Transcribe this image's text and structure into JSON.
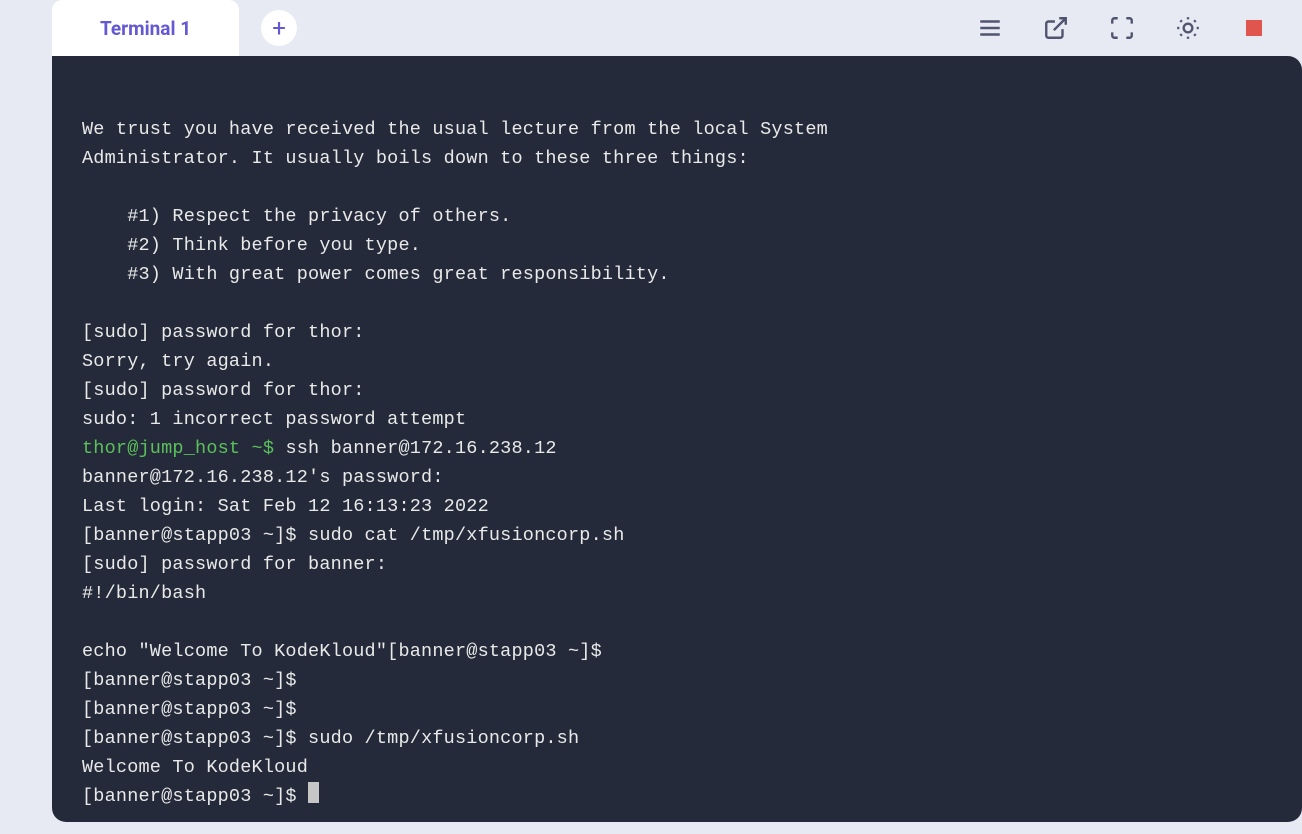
{
  "tabs": {
    "active": "Terminal 1"
  },
  "terminal": {
    "lecture_l1": "We trust you have received the usual lecture from the local System",
    "lecture_l2": "Administrator. It usually boils down to these three things:",
    "blank": "",
    "pt1": "    #1) Respect the privacy of others.",
    "pt2": "    #2) Think before you type.",
    "pt3": "    #3) With great power comes great responsibility.",
    "sudo_pw_thor1": "[sudo] password for thor: ",
    "sorry": "Sorry, try again.",
    "sudo_pw_thor2": "[sudo] password for thor: ",
    "sudo_fail": "sudo: 1 incorrect password attempt",
    "prompt_thor": "thor@jump_host ~$",
    "cmd_ssh_rest": " ssh banner@172.16.238.12",
    "ssh_pw": "banner@172.16.238.12's password: ",
    "last_login": "Last login: Sat Feb 12 16:13:23 2022",
    "p_banner": "[banner@stapp03 ~]$ ",
    "cmd_cat": "sudo cat /tmp/xfusioncorp.sh",
    "sudo_pw_banner": "[sudo] password for banner: ",
    "shebang": "#!/bin/bash",
    "echo_line": "echo \"Welcome To KodeKloud\"[banner@stapp03 ~]$ ",
    "cmd_run": "sudo /tmp/xfusioncorp.sh",
    "welcome": "Welcome To KodeKloud"
  }
}
